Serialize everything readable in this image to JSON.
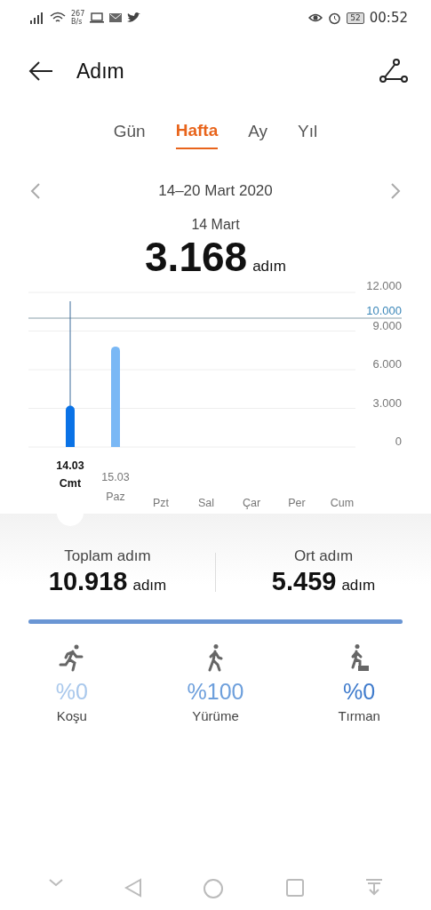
{
  "status_bar": {
    "speed_value": "267",
    "speed_unit": "B/s",
    "battery": "52",
    "time": "00:52"
  },
  "header": {
    "title": "Adım"
  },
  "tabs": [
    {
      "label": "Gün",
      "selected": false
    },
    {
      "label": "Hafta",
      "selected": true
    },
    {
      "label": "Ay",
      "selected": false
    },
    {
      "label": "Yıl",
      "selected": false
    }
  ],
  "period": {
    "range": "14–20 Mart 2020",
    "day": "14 Mart",
    "value": "3.168",
    "unit": "adım"
  },
  "chart": {
    "days": [
      {
        "date": "14.03",
        "name": "Cmt",
        "selected": true
      },
      {
        "date": "15.03",
        "name": "Paz",
        "selected": false
      },
      {
        "name": "Pzt",
        "selected": false
      },
      {
        "name": "Sal",
        "selected": false
      },
      {
        "name": "Çar",
        "selected": false
      },
      {
        "name": "Per",
        "selected": false
      },
      {
        "name": "Cum",
        "selected": false
      }
    ],
    "chart_data": {
      "type": "bar",
      "grid": true,
      "series": [
        {
          "color": "#0a72e6",
          "values": [
            3.2,
            null,
            null,
            null,
            null,
            null,
            null
          ]
        },
        {
          "color": "#7ab8f5",
          "values": [
            null,
            7.8,
            null,
            null,
            null,
            null,
            null
          ]
        }
      ],
      "ref_lines": [
        {
          "axis": "y",
          "value": 10,
          "label": "10.000",
          "color": "#8aa0aa"
        }
      ],
      "ylim": [
        0,
        12
      ],
      "yticks": [
        {
          "value": 0,
          "label": "0"
        },
        {
          "value": 3,
          "label": "3.000"
        },
        {
          "value": 6,
          "label": "6.000"
        },
        {
          "value": 9,
          "label": "9.000"
        },
        {
          "value": 12,
          "label": "12.000"
        }
      ]
    }
  },
  "summary": [
    {
      "label": "Toplam adım",
      "value": "10.918",
      "unit": "adım"
    },
    {
      "label": "Ort adım",
      "value": "5.459",
      "unit": "adım"
    }
  ],
  "breakdown": {
    "level": 1
  },
  "activities": [
    {
      "kind": "run",
      "percent": "%0",
      "label": "Koşu",
      "color": "#a9c8ec"
    },
    {
      "kind": "walk",
      "percent": "%100",
      "label": "Yürüme",
      "color": "#6d9fdc"
    },
    {
      "kind": "climb",
      "percent": "%0",
      "label": "Tırman",
      "color": "#3f7bcc"
    }
  ]
}
